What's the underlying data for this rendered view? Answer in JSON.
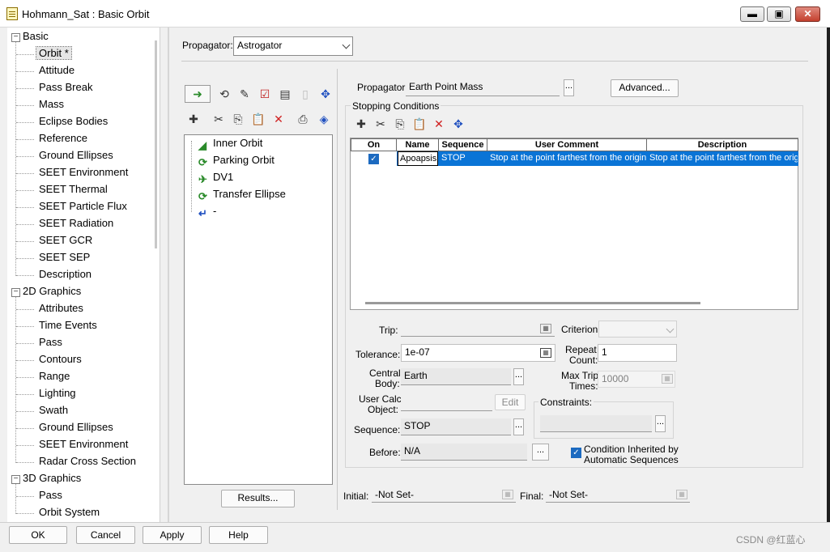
{
  "window": {
    "title": "Hohmann_Sat : Basic Orbit",
    "minimize_icon": "minimize-icon",
    "maximize_icon": "maximize-icon",
    "close_icon": "close-icon"
  },
  "tree": {
    "categories": [
      {
        "label": "Basic",
        "expander": "−",
        "items": [
          "Orbit *",
          "Attitude",
          "Pass Break",
          "Mass",
          "Eclipse Bodies",
          "Reference",
          "Ground Ellipses",
          "SEET Environment",
          "SEET Thermal",
          "SEET Particle Flux",
          "SEET Radiation",
          "SEET GCR",
          "SEET SEP",
          "Description"
        ]
      },
      {
        "label": "2D Graphics",
        "expander": "−",
        "items": [
          "Attributes",
          "Time Events",
          "Pass",
          "Contours",
          "Range",
          "Lighting",
          "Swath",
          "Ground Ellipses",
          "SEET Environment",
          "Radar Cross Section"
        ]
      },
      {
        "label": "3D Graphics",
        "expander": "−",
        "items": [
          "Pass",
          "Orbit System"
        ]
      }
    ],
    "selected": "Orbit *"
  },
  "propagator_top": {
    "label": "Propagator:",
    "value": "Astrogator"
  },
  "mcs": {
    "toolbar_row1": [
      "insert-segment-icon",
      "run-icon",
      "step-icon",
      "checkmark-icon",
      "summary-icon",
      "clear-icon",
      "target-icon"
    ],
    "toolbar_row2": [
      "new-icon",
      "cut-icon",
      "copy-icon",
      "paste-icon",
      "delete-icon",
      "print-icon",
      "navigate-icon"
    ],
    "segments": [
      {
        "label": "Inner Orbit",
        "icon": "initial-state-icon"
      },
      {
        "label": "Parking Orbit",
        "icon": "propagate-icon"
      },
      {
        "label": "DV1",
        "icon": "maneuver-icon"
      },
      {
        "label": "Transfer Ellipse",
        "icon": "propagate-icon"
      },
      {
        "label": "-",
        "icon": "return-arrow-icon"
      }
    ],
    "results_label": "Results..."
  },
  "segment": {
    "propagator_label": "Propagator:",
    "propagator_value": "Earth Point Mass",
    "advanced_label": "Advanced...",
    "stopping_conditions_label": "Stopping Conditions",
    "sc_toolbar": [
      "new-icon",
      "cut-icon",
      "copy-icon",
      "paste-icon",
      "delete-icon",
      "properties-icon"
    ],
    "grid": {
      "headers": [
        "On",
        "Name",
        "Sequence",
        "User Comment",
        "Description"
      ],
      "rows": [
        {
          "on": "✓",
          "name": "Apoapsis",
          "sequence": "STOP",
          "comment": "Stop at the point farthest from the origin",
          "description": "Stop at the point farthest from the orig"
        }
      ]
    },
    "form": {
      "trip_label": "Trip:",
      "trip_value": "",
      "criterion_label": "Criterion:",
      "criterion_value": "",
      "tolerance_label": "Tolerance:",
      "tolerance_value": "1e-07",
      "repeat_count_label_1": "Repeat",
      "repeat_count_label_2": "Count:",
      "repeat_count_value": "1",
      "central_body_label_1": "Central",
      "central_body_label_2": "Body:",
      "central_body_value": "Earth",
      "max_trip_label_1": "Max Trip",
      "max_trip_label_2": "Times:",
      "max_trip_value": "10000",
      "user_calc_label_1": "User Calc",
      "user_calc_label_2": "Object:",
      "user_calc_value": "",
      "edit_label": "Edit",
      "constraints_label": "Constraints:",
      "sequence_label": "Sequence:",
      "sequence_value": "STOP",
      "before_label": "Before:",
      "before_value": "N/A",
      "inherited_label_1": "Condition Inherited by",
      "inherited_label_2": "Automatic Sequences",
      "inherited_checked": "✓",
      "dots": "...",
      "initial_label": "Initial:",
      "initial_value": "-Not Set-",
      "final_label": "Final:",
      "final_value": "-Not Set-"
    }
  },
  "dialog_buttons": {
    "ok": "OK",
    "cancel": "Cancel",
    "apply": "Apply",
    "help": "Help"
  },
  "watermark": "CSDN @红蓝心"
}
